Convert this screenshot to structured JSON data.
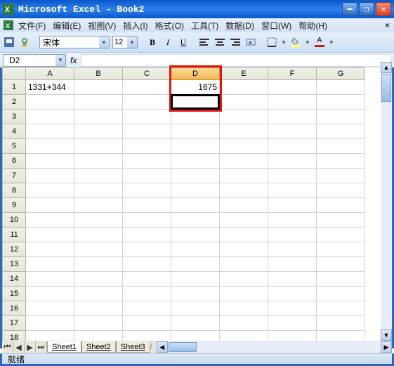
{
  "window": {
    "title": "Microsoft Excel - Book2"
  },
  "menu": {
    "file": "文件(F)",
    "edit": "编辑(E)",
    "view": "视图(V)",
    "insert": "插入(I)",
    "format": "格式(O)",
    "tools": "工具(T)",
    "data": "数据(D)",
    "window": "窗口(W)",
    "help": "帮助(H)"
  },
  "toolbar": {
    "font_name": "宋体",
    "font_size": "12",
    "bold": "B",
    "italic": "I",
    "underline": "U",
    "font_color_letter": "A"
  },
  "formula": {
    "name_box": "D2",
    "fx": "fx",
    "value": ""
  },
  "grid": {
    "columns": [
      "A",
      "B",
      "C",
      "D",
      "E",
      "F",
      "G"
    ],
    "rows": [
      "1",
      "2",
      "3",
      "4",
      "5",
      "6",
      "7",
      "8",
      "9",
      "10",
      "11",
      "12",
      "13",
      "14",
      "15",
      "16",
      "17",
      "18"
    ],
    "selected_column": "D",
    "selected_cell": "D2",
    "cells": {
      "A1": "1331+344",
      "D1": "1675"
    }
  },
  "sheets": {
    "items": [
      "Sheet1",
      "Sheet2",
      "Sheet3"
    ],
    "active": "Sheet1"
  },
  "status": {
    "text": "就绪"
  }
}
